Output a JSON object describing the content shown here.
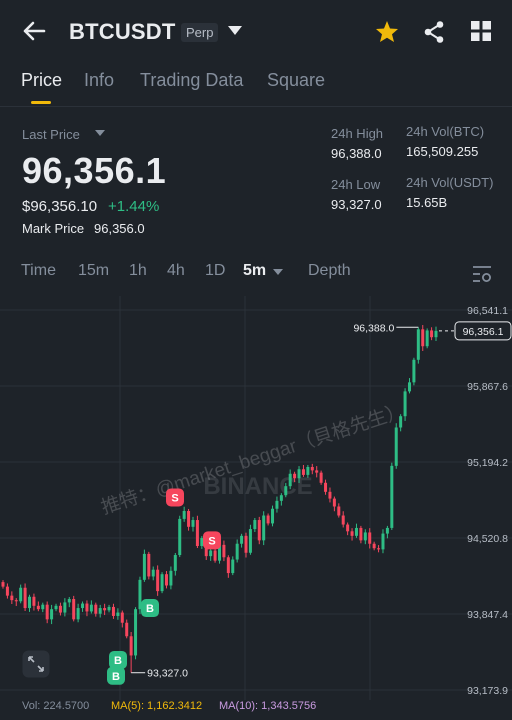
{
  "header": {
    "symbol": "BTCUSDT",
    "contract_badge": "Perp"
  },
  "tabs": [
    "Price",
    "Info",
    "Trading Data",
    "Square"
  ],
  "ticker": {
    "last_price_label": "Last Price",
    "last_price": "96,356.1",
    "usd_value": "$96,356.10",
    "change_pct": "+1.44%",
    "mark_price_label": "Mark Price",
    "mark_price": "96,356.0",
    "high_label": "24h High",
    "high": "96,388.0",
    "low_label": "24h Low",
    "low": "93,327.0",
    "vol_btc_label": "24h Vol(BTC)",
    "vol_btc": "165,509.255",
    "vol_usdt_label": "24h Vol(USDT)",
    "vol_usdt": "15.65B"
  },
  "timeframes": {
    "time": "Time",
    "m15": "15m",
    "h1": "1h",
    "h4": "4h",
    "d1": "1D",
    "m5": "5m",
    "depth": "Depth"
  },
  "chart_data": {
    "type": "candlestick",
    "interval": "5m",
    "y_ticks": [
      "96,541.1",
      "95,867.6",
      "95,194.2",
      "94,520.8",
      "93,847.4",
      "93,173.9"
    ],
    "y_range": [
      93173.9,
      96541.1
    ],
    "high_label": "96,388.0",
    "low_label": "93,327.0",
    "current_price_label": "96,356.1",
    "current_price": 96356.1,
    "markers": [
      {
        "type": "S",
        "price": 94880
      },
      {
        "type": "S",
        "price": 94500
      },
      {
        "type": "B",
        "price": 93900
      },
      {
        "type": "B",
        "price": 93440
      },
      {
        "type": "B",
        "price": 93300
      }
    ],
    "closes": [
      94090,
      94010,
      93970,
      93960,
      94080,
      93900,
      94000,
      93920,
      93890,
      93930,
      93800,
      93890,
      93920,
      93860,
      93950,
      93980,
      93800,
      93900,
      93940,
      93870,
      93930,
      93850,
      93900,
      93880,
      93910,
      93830,
      93860,
      93770,
      93650,
      93480,
      93890,
      94150,
      94380,
      94180,
      94240,
      94050,
      94200,
      94100,
      94230,
      94370,
      94690,
      94760,
      94620,
      94680,
      94450,
      94520,
      94360,
      94410,
      94320,
      94460,
      94350,
      94210,
      94330,
      94470,
      94540,
      94390,
      94600,
      94680,
      94500,
      94720,
      94650,
      94780,
      94850,
      94900,
      94980,
      95090,
      95050,
      95130,
      95080,
      95150,
      95120,
      95100,
      95010,
      94930,
      94870,
      94800,
      94720,
      94640,
      94580,
      94540,
      94610,
      94500,
      94570,
      94470,
      94430,
      94420,
      94560,
      94610,
      95160,
      95500,
      95600,
      95820,
      95900,
      96100,
      96370,
      96220,
      96360,
      96300,
      96356
    ]
  },
  "watermark": "推特：@market_beggar（貝格先生）",
  "brand_watermark": "BINANCE",
  "volume": {
    "vol_label": "Vol: 224.5700",
    "ma5_label": "MA(5): 1,162.3412",
    "ma10_label": "MA(10): 1,343.5756"
  },
  "colors": {
    "up": "#2ebd85",
    "down": "#f6465d",
    "accent": "#f0b90b",
    "background": "#1e2329"
  }
}
